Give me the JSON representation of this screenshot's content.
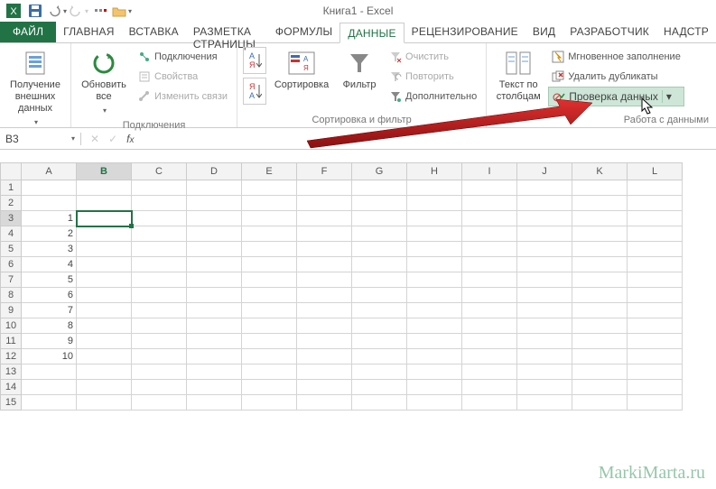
{
  "app": {
    "title": "Книга1 - Excel"
  },
  "qat": {
    "excel_icon": "X",
    "save": "💾"
  },
  "tabs": {
    "file": "ФАЙЛ",
    "items": [
      "ГЛАВНАЯ",
      "ВСТАВКА",
      "РАЗМЕТКА СТРАНИЦЫ",
      "ФОРМУЛЫ",
      "ДАННЫЕ",
      "РЕЦЕНЗИРОВАНИЕ",
      "ВИД",
      "РАЗРАБОТЧИК",
      "НАДСТР"
    ],
    "active_index": 4
  },
  "ribbon": {
    "get_external": {
      "label": "Получение\nвнешних данных"
    },
    "connections": {
      "refresh": "Обновить\nвсе",
      "conn": "Подключения",
      "props": "Свойства",
      "editlinks": "Изменить связи",
      "group": "Подключения"
    },
    "sort": {
      "sort": "Сортировка",
      "filter": "Фильтр",
      "clear": "Очистить",
      "reapply": "Повторить",
      "advanced": "Дополнительно",
      "group": "Сортировка и фильтр"
    },
    "tools": {
      "textcols": "Текст по\nстолбцам",
      "flash": "Мгновенное заполнение",
      "dedup": "Удалить дубликаты",
      "validate": "Проверка данных",
      "group": "Работа с данными"
    }
  },
  "namebox": "B3",
  "columns": [
    "A",
    "B",
    "C",
    "D",
    "E",
    "F",
    "G",
    "H",
    "I",
    "J",
    "K",
    "L"
  ],
  "rows": [
    {
      "n": 1,
      "A": ""
    },
    {
      "n": 2,
      "A": ""
    },
    {
      "n": 3,
      "A": "1"
    },
    {
      "n": 4,
      "A": "2"
    },
    {
      "n": 5,
      "A": "3"
    },
    {
      "n": 6,
      "A": "4"
    },
    {
      "n": 7,
      "A": "5"
    },
    {
      "n": 8,
      "A": "6"
    },
    {
      "n": 9,
      "A": "7"
    },
    {
      "n": 10,
      "A": "8"
    },
    {
      "n": 11,
      "A": "9"
    },
    {
      "n": 12,
      "A": "10"
    },
    {
      "n": 13,
      "A": ""
    },
    {
      "n": 14,
      "A": ""
    },
    {
      "n": 15,
      "A": ""
    }
  ],
  "selected": {
    "row": 3,
    "col": "B"
  },
  "watermark": "MarkiMarta.ru"
}
